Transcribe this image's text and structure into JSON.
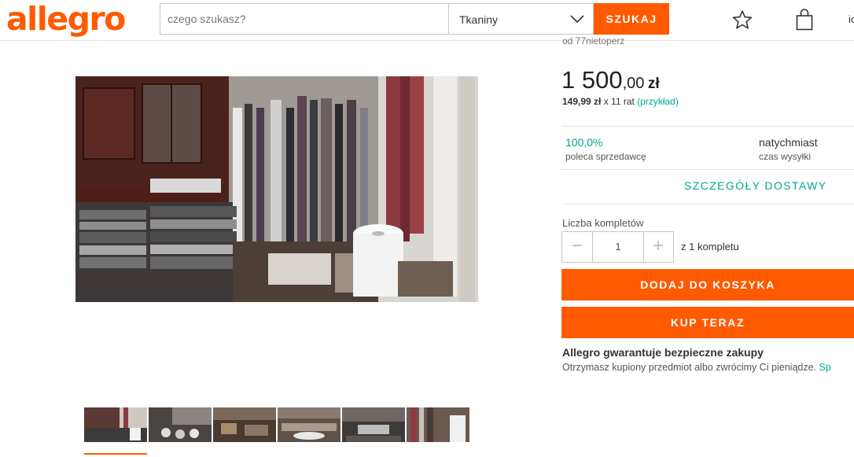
{
  "header": {
    "logo": "allegro",
    "search_placeholder": "czego szukasz?",
    "category": "Tkaniny",
    "search_button": "SZUKAJ",
    "cut_text": "ic"
  },
  "offer": {
    "seller_cut": "od  77nietoperz",
    "price_main": "1 500",
    "price_fraction": ",00",
    "currency": "zł",
    "installment_amount": "149,99 zł",
    "installment_times": " x 11 rat ",
    "installment_link": "(przykład)",
    "recommend_value": "100,0%",
    "recommend_label": "poleca sprzedawcę",
    "shipping_value": "natychmiast",
    "shipping_label": "czas wysyłki",
    "delivery_link": "SZCZEGÓŁY DOSTAWY",
    "qty_label": "Liczba kompletów",
    "qty_minus": "−",
    "qty_value": "1",
    "qty_plus": "+",
    "qty_note": "z 1 kompletu",
    "add_to_cart": "DODAJ DO KOSZYKA",
    "buy_now": "KUP TERAZ",
    "guarantee_title": "Allegro gwarantuje bezpieczne zakupy",
    "guarantee_text": "Otrzymasz kupiony przedmiot albo zwrócimy Ci pieniądze. ",
    "guarantee_link": "Sp"
  },
  "gallery": {
    "thumbnail_count": 6
  },
  "colors": {
    "accent": "#ff5a00",
    "link": "#00a790"
  }
}
